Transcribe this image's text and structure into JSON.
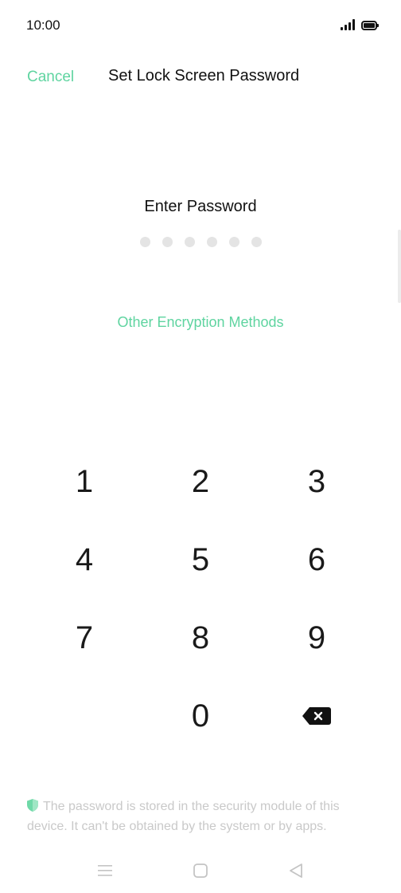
{
  "status_bar": {
    "time": "10:00"
  },
  "header": {
    "cancel_label": "Cancel",
    "title": "Set Lock Screen Password"
  },
  "password": {
    "prompt": "Enter Password",
    "dot_count": 6
  },
  "other_methods_label": "Other Encryption Methods",
  "keypad": {
    "keys": [
      "1",
      "2",
      "3",
      "4",
      "5",
      "6",
      "7",
      "8",
      "9",
      "",
      "0",
      "backspace"
    ]
  },
  "footer": {
    "note": "The password is stored in the security module of this device. It can't be obtained by the system or by apps."
  },
  "colors": {
    "accent": "#5fd4a0",
    "muted_text": "#c9c9c9",
    "dot": "#e4e4e4"
  },
  "icons": {
    "signal": "signal-icon",
    "battery": "battery-icon",
    "backspace": "backspace-icon",
    "shield": "shield-icon",
    "nav_menu": "menu-icon",
    "nav_home": "home-icon",
    "nav_back": "back-icon"
  }
}
